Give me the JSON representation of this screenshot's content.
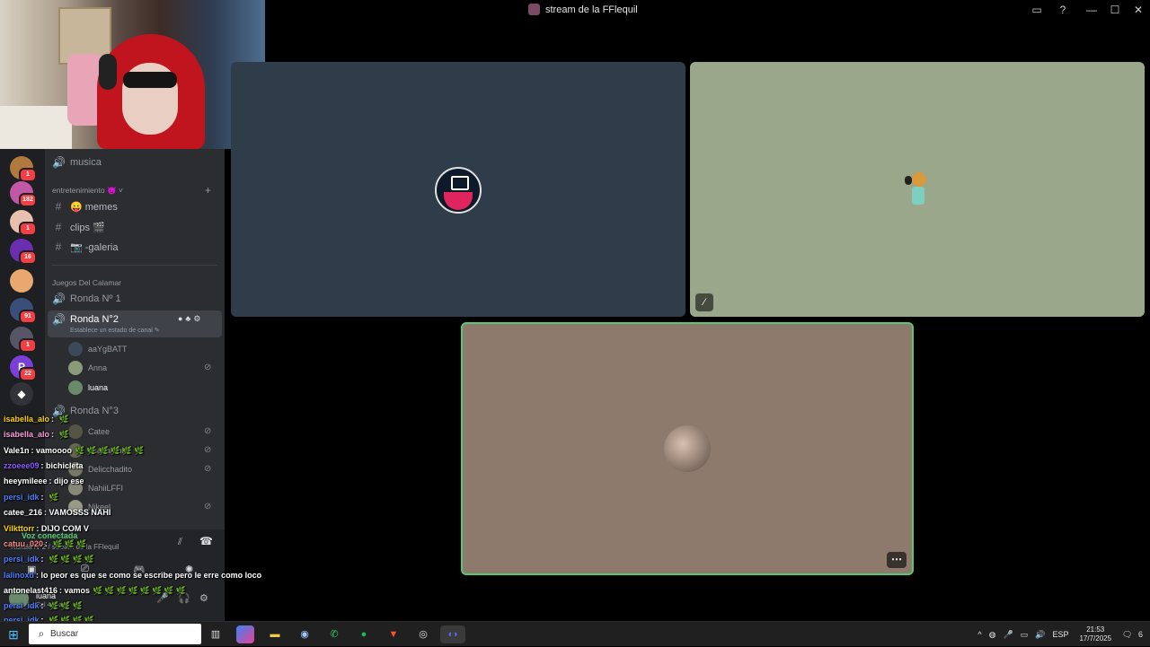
{
  "window": {
    "title": "stream de la FFlequil"
  },
  "server_badges": [
    "1",
    "182",
    "1",
    "16",
    "",
    "91",
    "1",
    "22",
    ""
  ],
  "channels": {
    "text_top": {
      "name": "musica"
    },
    "category1": "entretenimiento 👿",
    "text": [
      {
        "name": "😛 memes"
      },
      {
        "name": "clips 🎬"
      },
      {
        "name": "📷 -galeria"
      }
    ],
    "category2": "Juegos Del Calamar",
    "voice1": "Ronda Nº 1",
    "voice2": "Ronda N°2",
    "voice2_status": "Establece un estado de canal",
    "voice2_users": [
      "aaYgBATT",
      "Anna",
      "luana"
    ],
    "voice3": "Ronda N°3",
    "voice3_users": [
      "Catee",
      "d4a4a4 bb",
      "Delicchadito",
      "NahiiLFFI",
      "Nikeel"
    ]
  },
  "voice_panel": {
    "status": "Voz conectada",
    "sub": "Ronda N°2 / stream de la FFlequil",
    "user": "luana",
    "user_sub": "Cal 4 voz"
  },
  "chat": [
    {
      "user": "isabella_alo",
      "text": "",
      "emotes": "🌿",
      "color": "#ffd400"
    },
    {
      "user": "isabella_alo",
      "text": "",
      "emotes": "🌿",
      "color": "#ff9be0"
    },
    {
      "user": "Vale1n",
      "text": "vamoooo",
      "emotes": "🌿🌿🌿🌿🌿🌿",
      "color": "#ffffff"
    },
    {
      "user": "zzoeee09",
      "text": "bichicleta",
      "emotes": "",
      "color": "#8a5cff"
    },
    {
      "user": "heeymileee",
      "text": "dijo ese",
      "emotes": "",
      "color": "#ffffff"
    },
    {
      "user": "persi_idk",
      "text": "",
      "emotes": "🌿",
      "color": "#4c7fff"
    },
    {
      "user": "catee_216",
      "text": "VAMOSSS NAHI",
      "emotes": "",
      "color": "#ffffff"
    },
    {
      "user": "Vilkttorr",
      "text": "DIJO COM V",
      "emotes": "",
      "color": "#ffd400"
    },
    {
      "user": "catuu_020",
      "text": "",
      "emotes": "🌿🌿🌿",
      "color": "#ff8a8a"
    },
    {
      "user": "persi_idk",
      "text": "",
      "emotes": "🌿🌿🌿🌿",
      "color": "#4c7fff"
    },
    {
      "user": "lalinoxd",
      "text": "lo peor es que se como se escribe pero le erre como loco",
      "emotes": "",
      "color": "#4c7fff"
    },
    {
      "user": "antonelast416",
      "text": "vamos",
      "emotes": "🌿🌿🌿🌿🌿🌿🌿🌿",
      "color": "#ffffff"
    },
    {
      "user": "persi_idk",
      "text": "",
      "emotes": "🌿🌿🌿",
      "color": "#4c7fff"
    },
    {
      "user": "persi_idk",
      "text": "",
      "emotes": "🌿🌿🌿🌿",
      "color": "#4c7fff"
    }
  ],
  "taskbar": {
    "search_placeholder": "Buscar",
    "lang": "ESP",
    "time": "21:53",
    "date": "17/7/2025",
    "notif": "6"
  },
  "colors": {
    "accent": "#5865f2",
    "speaking": "#58c774",
    "rail": "#1e1f22",
    "channels": "#2b2d31"
  }
}
